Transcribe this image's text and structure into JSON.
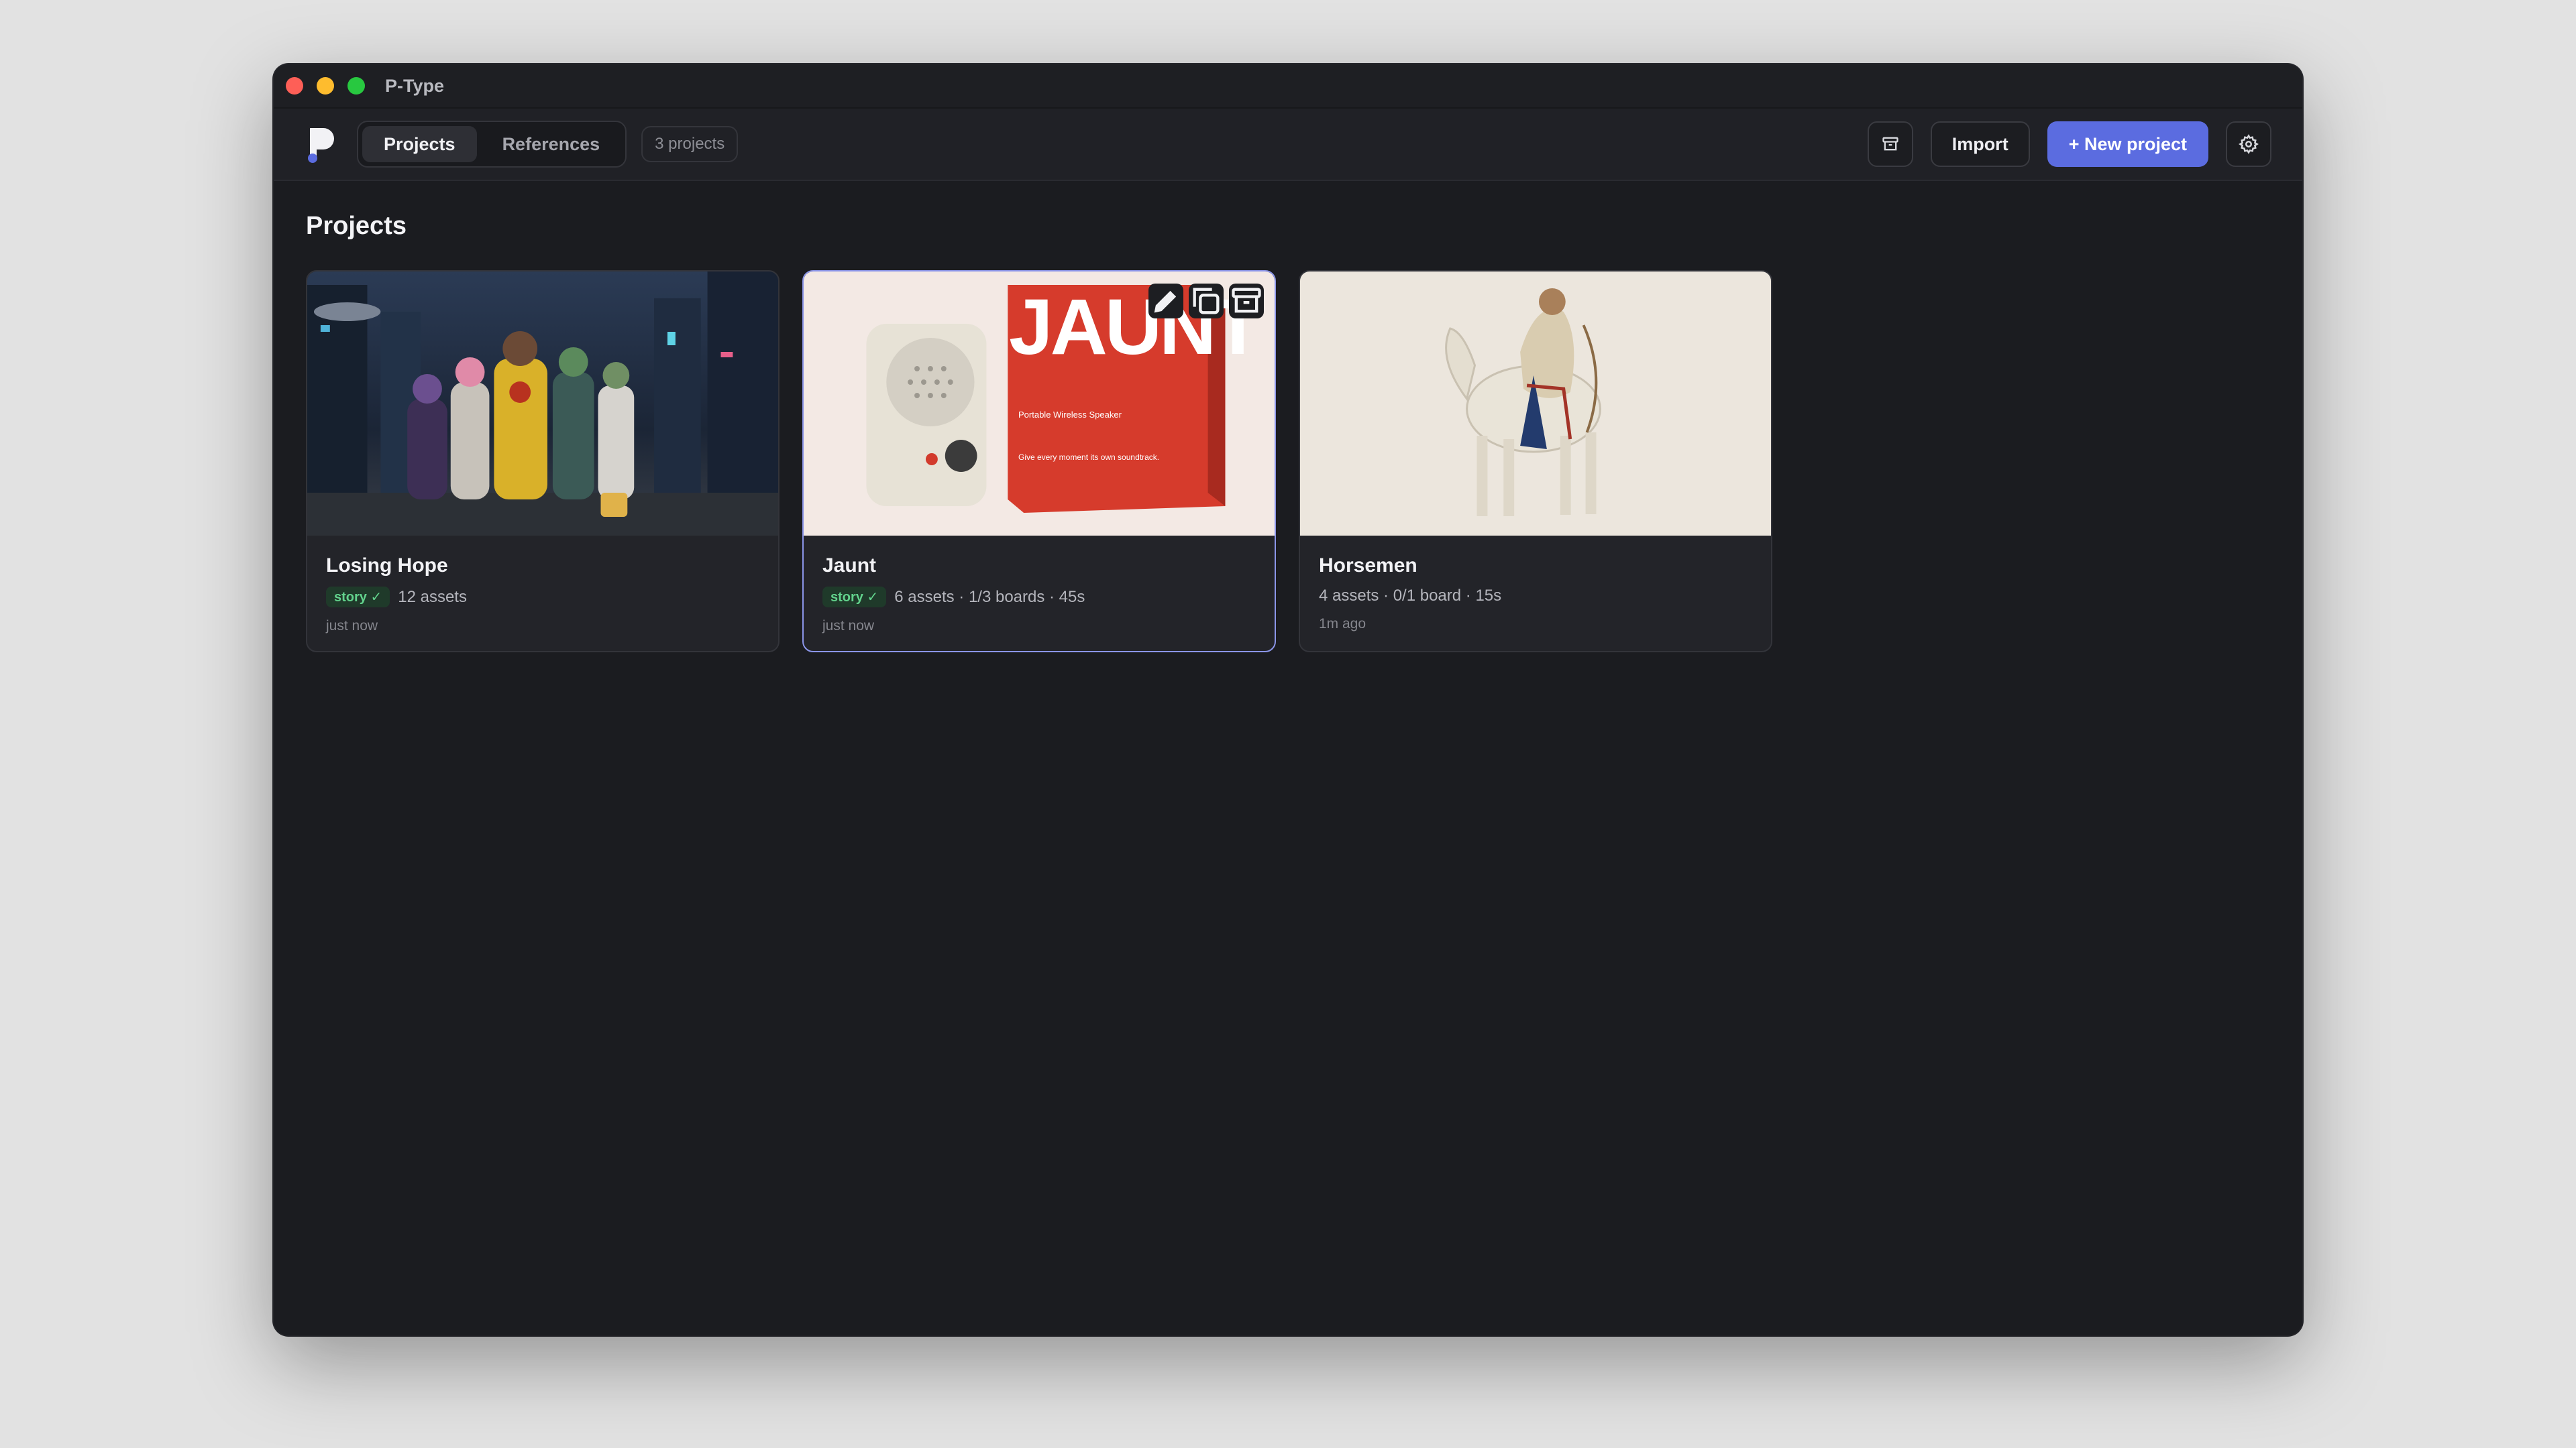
{
  "window": {
    "title": "P-Type"
  },
  "toolbar": {
    "tabs": [
      {
        "label": "Projects",
        "active": true
      },
      {
        "label": "References",
        "active": false
      }
    ],
    "count": "3 projects",
    "archive_icon": "archive-icon",
    "import_label": "Import",
    "new_project_label": "+ New project",
    "settings_icon": "gear-icon"
  },
  "main": {
    "section_title": "Projects",
    "projects": [
      {
        "title": "Losing Hope",
        "badge": "story ✓",
        "meta": "12 assets",
        "time": "just now",
        "thumbnail": "cyberpunk-crew-image"
      },
      {
        "title": "Jaunt",
        "badge": "story ✓",
        "meta": "6 assets · 1/3 boards · 45s",
        "time": "just now",
        "thumbnail": "speaker-product-image",
        "box_brand": "JAUNT",
        "box_lines": [
          "Portable Wireless Speaker",
          "Give every moment its own soundtrack."
        ],
        "actions": [
          "pencil-icon",
          "copy-icon",
          "archive-icon"
        ]
      },
      {
        "title": "Horsemen",
        "badge": "",
        "meta": "4 assets · 0/1 board · 15s",
        "time": "1m ago",
        "thumbnail": "horseman-image"
      }
    ]
  },
  "colors": {
    "accent": "#5b6ce0",
    "badge_text": "#62d28c",
    "window_bg": "#1b1c20"
  }
}
